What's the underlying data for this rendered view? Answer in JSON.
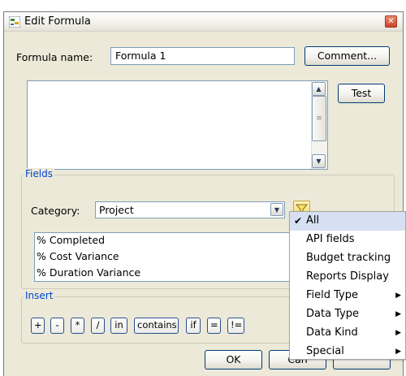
{
  "window": {
    "title": "Edit Formula"
  },
  "form": {
    "name_label": "Formula name:",
    "name_value": "Formula 1",
    "comment_button": "Comment...",
    "test_button": "Test"
  },
  "fields_group": {
    "title": "Fields",
    "category_label": "Category:",
    "category_value": "Project",
    "items": [
      "% Completed",
      "% Cost Variance",
      "% Duration Variance"
    ]
  },
  "insert_group": {
    "title": "Insert",
    "operators": [
      "+",
      "-",
      "*",
      "/",
      "in",
      "contains",
      "if",
      "=",
      "!="
    ]
  },
  "footer": {
    "ok_button": "OK",
    "cancel_button": "Can"
  },
  "filter_menu": {
    "items": [
      {
        "label": "All",
        "checked": true,
        "submenu": false
      },
      {
        "label": "API fields",
        "checked": false,
        "submenu": false
      },
      {
        "label": "Budget tracking",
        "checked": false,
        "submenu": false
      },
      {
        "label": "Reports Display",
        "checked": false,
        "submenu": false
      },
      {
        "label": "Field Type",
        "checked": false,
        "submenu": true
      },
      {
        "label": "Data Type",
        "checked": false,
        "submenu": true
      },
      {
        "label": "Data Kind",
        "checked": false,
        "submenu": true
      },
      {
        "label": "Special",
        "checked": false,
        "submenu": true
      }
    ]
  },
  "colors": {
    "group_title": "#0046d5",
    "dialog_bg": "#ece9d8",
    "menu_highlight": "#d6e0f2",
    "filter_icon": "#f3d35b"
  }
}
